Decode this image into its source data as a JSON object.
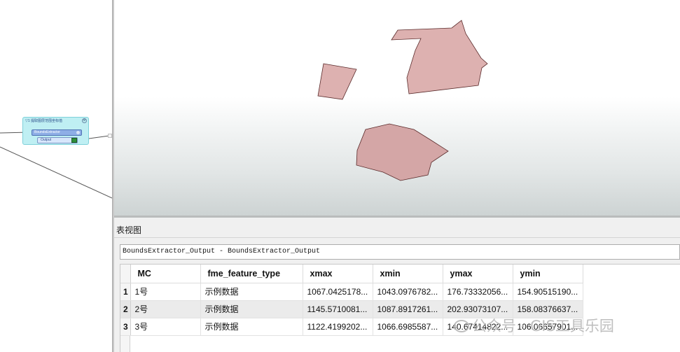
{
  "workspace": {
    "transformer": {
      "title": "▽1 提取图层范围坐标值",
      "input_port": "BoundsExtractor",
      "output_port": "Output"
    }
  },
  "map": {
    "polygon_fill": "#ddb1b0",
    "polygon_fill_lower": "#d4a6a6",
    "polygon_stroke": "#5a2a2a"
  },
  "table_view": {
    "title": "表视图",
    "source_label": "BoundsExtractor_Output - BoundsExtractor_Output",
    "columns": [
      "MC",
      "fme_feature_type",
      "xmax",
      "xmin",
      "ymax",
      "ymin"
    ],
    "rows": [
      {
        "index": "1",
        "cells": [
          "1号",
          "示例数据",
          "1067.0425178...",
          "1043.0976782...",
          "176.73332056...",
          "154.90515190..."
        ]
      },
      {
        "index": "2",
        "cells": [
          "2号",
          "示例数据",
          "1145.5710081...",
          "1087.8917261...",
          "202.93073107...",
          "158.08376637..."
        ]
      },
      {
        "index": "3",
        "cells": [
          "3号",
          "示例数据",
          "1122.4199202...",
          "1066.6985587...",
          "140.67414822...",
          "106.06657901..."
        ]
      }
    ]
  },
  "watermark": {
    "text": "公众号 · GIS工具乐园",
    "icon": "wechat-icon"
  }
}
